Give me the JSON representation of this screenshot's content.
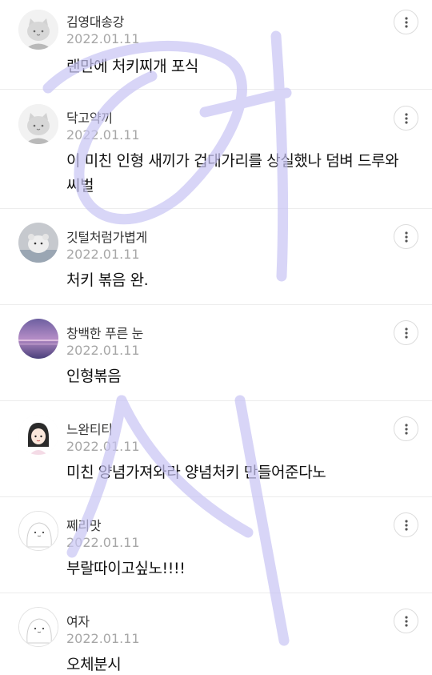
{
  "comments": [
    {
      "author": "김영대송강",
      "date": "2022.01.11",
      "text": "랜만에 처키찌개 포식",
      "avatar_icon": "cat-avatar-icon"
    },
    {
      "author": "닥고약끼",
      "date": "2022.01.11",
      "text": "이 미친 인형 새끼가 겁대가리를 상실했나 덤벼 드루와 씨벌",
      "avatar_icon": "cat-avatar-icon"
    },
    {
      "author": "깃털처럼가볍게",
      "date": "2022.01.11",
      "text": "처키 볶음 완.",
      "avatar_icon": "hamster-photo-icon"
    },
    {
      "author": "창백한 푸른 눈",
      "date": "2022.01.11",
      "text": "인형볶음",
      "avatar_icon": "purple-sunset-photo-icon"
    },
    {
      "author": "느완티티",
      "date": "2022.01.11",
      "text": "미친 양념가져와라 양념처키 만들어준다노",
      "avatar_icon": "girl-drawing-icon"
    },
    {
      "author": "쩨리맛",
      "date": "2022.01.11",
      "text": "부랄따이고싶노!!!!",
      "avatar_icon": "white-blob-avatar-icon"
    },
    {
      "author": "여자",
      "date": "2022.01.11",
      "text": "오체분시",
      "avatar_icon": "white-blob-avatar-icon"
    }
  ],
  "colors": {
    "author": "#333333",
    "date": "#a7a7a7",
    "text": "#111111",
    "divider": "#ececec",
    "watermark": "#c8c4f4"
  },
  "icons": {
    "more": "more-vertical-icon",
    "watermark": "handwritten-watermark-icon"
  }
}
